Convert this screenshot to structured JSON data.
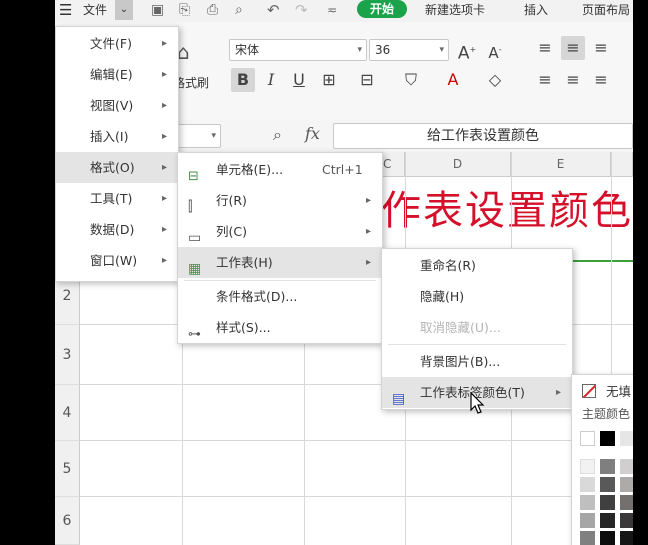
{
  "topbar": {
    "file_label": "文件",
    "tab_start": "开始",
    "tab_new": "新建选项卡",
    "tab_insert": "插入",
    "tab_layout": "页面布局"
  },
  "ribbon": {
    "format_painter": "格式刷",
    "font_name": "宋体",
    "font_size": "36"
  },
  "formula_bar": {
    "fx": "fx",
    "content": "给工作表设置颜色"
  },
  "grid": {
    "columns": [
      "C",
      "D",
      "E"
    ],
    "rows": [
      "2",
      "3",
      "4",
      "5",
      "6"
    ],
    "title_text": "作表设置颜色"
  },
  "main_menu": {
    "items": [
      {
        "label": "文件(F)"
      },
      {
        "label": "编辑(E)"
      },
      {
        "label": "视图(V)"
      },
      {
        "label": "插入(I)"
      },
      {
        "label": "格式(O)"
      },
      {
        "label": "工具(T)"
      },
      {
        "label": "数据(D)"
      },
      {
        "label": "窗口(W)"
      }
    ]
  },
  "format_menu": {
    "items": [
      {
        "label": "单元格(E)...",
        "shortcut": "Ctrl+1"
      },
      {
        "label": "行(R)"
      },
      {
        "label": "列(C)"
      },
      {
        "label": "工作表(H)"
      },
      {
        "label": "条件格式(D)..."
      },
      {
        "label": "样式(S)..."
      }
    ]
  },
  "sheet_menu": {
    "items": [
      {
        "label": "重命名(R)"
      },
      {
        "label": "隐藏(H)"
      },
      {
        "label": "取消隐藏(U)..."
      },
      {
        "label": "背景图片(B)..."
      },
      {
        "label": "工作表标签颜色(T)"
      }
    ]
  },
  "color_menu": {
    "no_fill": "无填",
    "theme_label": "主题颜色"
  },
  "colors": {
    "accent_green": "#1aa34a",
    "title_red": "#d4102a",
    "theme_swatches": [
      "#ffffff",
      "#000000",
      "#e7e6e6",
      "#f2f2f2",
      "#7f7f7f",
      "#d0cece",
      "#d9d9d9",
      "#595959",
      "#aeaaaa",
      "#bfbfbf",
      "#404040",
      "#757070",
      "#a6a6a6",
      "#262626",
      "#3a3838",
      "#808080",
      "#0d0d0d",
      "#161616"
    ]
  }
}
